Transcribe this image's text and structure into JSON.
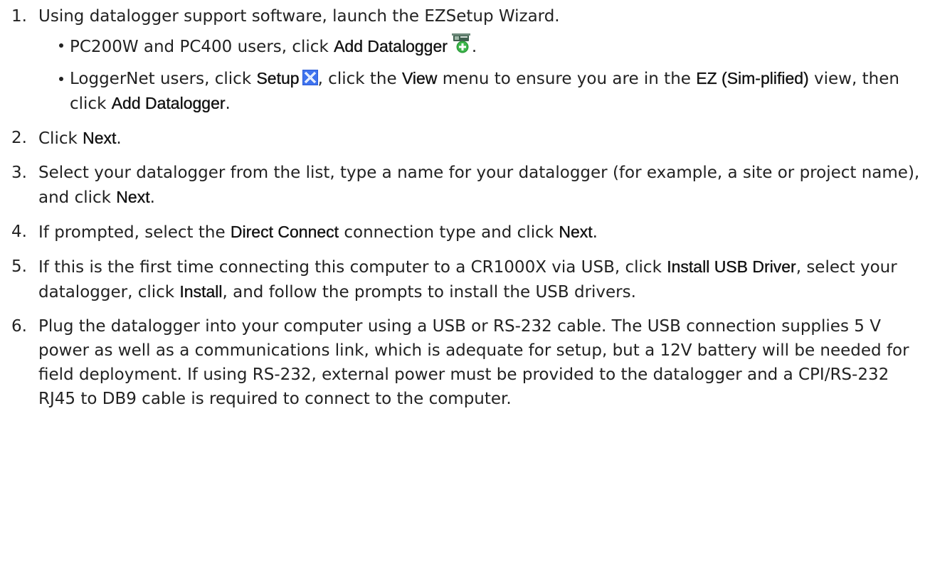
{
  "steps": [
    {
      "number": "1.",
      "text": "Using datalogger support software, launch the EZSetup Wizard.",
      "bullets": [
        {
          "before": "PC200W and PC400 users, click ",
          "bold1": "Add Datalogger",
          "after": "."
        },
        {
          "before": "LoggerNet users, click ",
          "bold1": "Setup",
          "mid1": ", click the ",
          "bold2": "View",
          "mid2": " menu to ensure you are in the ",
          "bold3": "EZ (Sim-plified)",
          "mid3": " view, then click ",
          "bold4": "Add Datalogger",
          "after": "."
        }
      ]
    },
    {
      "number": "2.",
      "before": "Click ",
      "bold1": "Next",
      "after": "."
    },
    {
      "number": "3.",
      "before": "Select your datalogger from the list, type a name for your datalogger (for example, a site or project name), and click ",
      "bold1": "Next",
      "after": "."
    },
    {
      "number": "4.",
      "before": "If prompted, select the ",
      "bold1": "Direct Connect",
      "mid1": " connection type and click ",
      "bold2": "Next",
      "after": "."
    },
    {
      "number": "5.",
      "before": "If this is the first time connecting this computer to a CR1000X via USB, click ",
      "bold1": "Install USB Driver",
      "mid1": ", select your datalogger, click ",
      "bold2": "Install",
      "after": ", and follow the prompts to install the USB drivers."
    },
    {
      "number": "6.",
      "text": "Plug the datalogger into your computer using a USB or RS-232 cable. The USB connection supplies 5 V power as well as a communications link, which is adequate for setup, but a 12V battery will be needed for field deployment. If using RS-232, external power must be provided to the datalogger and a CPI/RS-232 RJ45 to DB9 cable is required to connect to the computer."
    }
  ],
  "icons": {
    "add_datalogger": "add-datalogger-icon",
    "setup": "setup-icon"
  }
}
